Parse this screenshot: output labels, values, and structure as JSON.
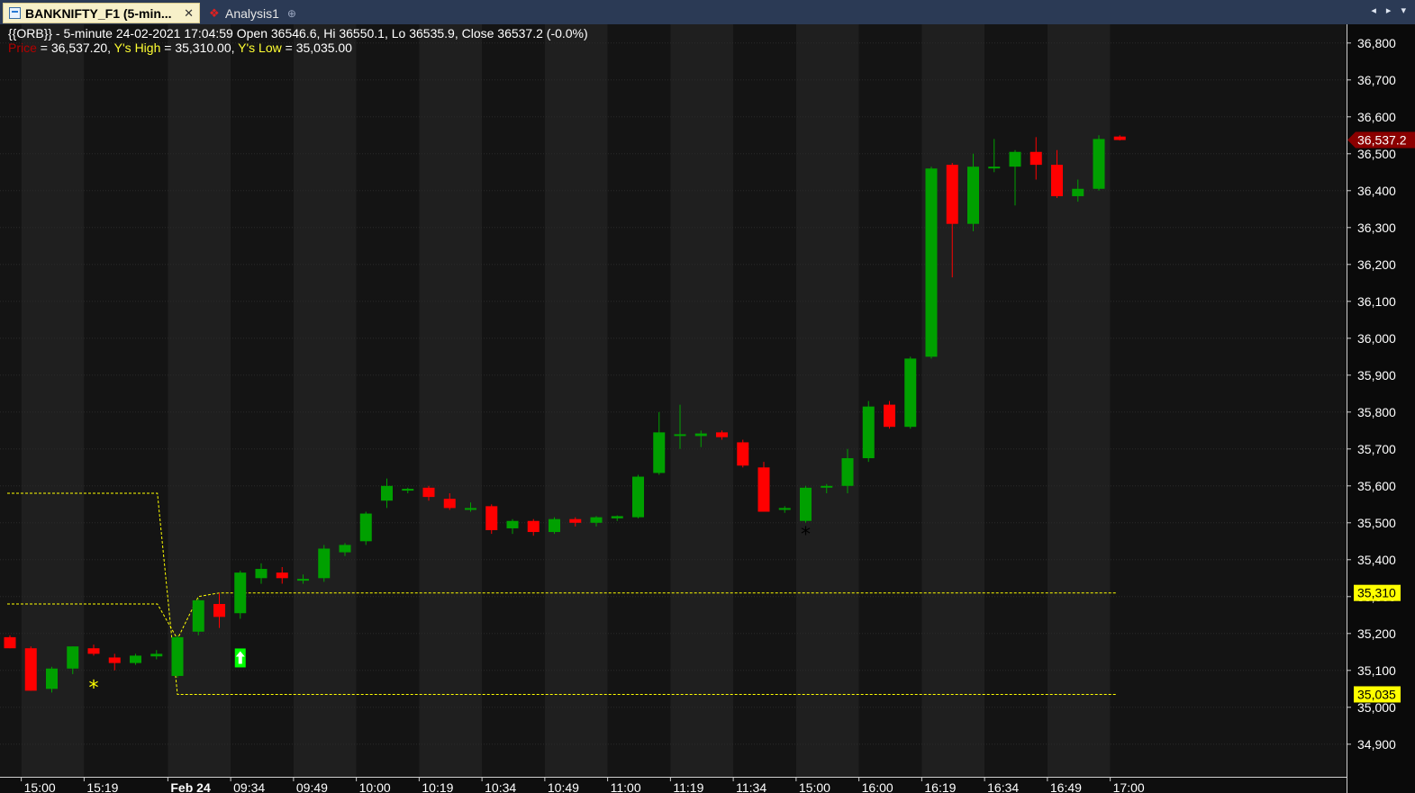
{
  "tabs": [
    {
      "label": "BANKNIFTY_F1 (5-min...",
      "active": true,
      "icon": "chart-window-icon"
    },
    {
      "label": "Analysis1",
      "active": false,
      "icon": "analysis-icon"
    }
  ],
  "info": {
    "line1": "{{ORB}} - 5-minute 24-02-2021 17:04:59 Open 36546.6, Hi 36550.1, Lo 36535.9, Close 36537.2 (-0.0%)",
    "price_label": "Price",
    "price_value": " = 36,537.20, ",
    "yhigh_label": "Y's High",
    "yhigh_value": " = 35,310.00, ",
    "ylow_label": "Y's Low",
    "ylow_value": " = 35,035.00"
  },
  "chart_data": {
    "type": "candlestick",
    "title": "",
    "ylim": [
      34840,
      36830
    ],
    "y_ticks": [
      34900,
      35000,
      35100,
      35200,
      35300,
      35400,
      35500,
      35600,
      35700,
      35800,
      35900,
      36000,
      36100,
      36200,
      36300,
      36400,
      36500,
      36600,
      36700,
      36800
    ],
    "y_tick_labels": [
      "34,900",
      "35,000",
      "35,100",
      "35,200",
      "35,300",
      "35,400",
      "35,500",
      "35,600",
      "35,700",
      "35,800",
      "35,900",
      "36,000",
      "36,100",
      "36,200",
      "36,300",
      "36,400",
      "36,500",
      "36,600",
      "36,700",
      "36,800"
    ],
    "x_tick_labels": [
      {
        "bar": 1,
        "label": "15:00",
        "bold": false
      },
      {
        "bar": 4,
        "label": "15:19",
        "bold": false
      },
      {
        "bar": 8,
        "label": "Feb 24",
        "bold": true
      },
      {
        "bar": 11,
        "label": "09:34",
        "bold": false
      },
      {
        "bar": 14,
        "label": "09:49",
        "bold": false
      },
      {
        "bar": 17,
        "label": "10:00",
        "bold": false
      },
      {
        "bar": 20,
        "label": "10:19",
        "bold": false
      },
      {
        "bar": 23,
        "label": "10:34",
        "bold": false
      },
      {
        "bar": 26,
        "label": "10:49",
        "bold": false
      },
      {
        "bar": 29,
        "label": "11:00",
        "bold": false
      },
      {
        "bar": 32,
        "label": "11:19",
        "bold": false
      },
      {
        "bar": 35,
        "label": "11:34",
        "bold": false
      },
      {
        "bar": 38,
        "label": "15:00",
        "bold": false
      },
      {
        "bar": 41,
        "label": "16:00",
        "bold": false
      },
      {
        "bar": 44,
        "label": "16:19",
        "bold": false
      },
      {
        "bar": 47,
        "label": "16:34",
        "bold": false
      },
      {
        "bar": 50,
        "label": "16:49",
        "bold": false
      },
      {
        "bar": 53,
        "label": "17:00",
        "bold": false
      }
    ],
    "candles": [
      {
        "o": 35190,
        "h": 35195,
        "l": 35160,
        "c": 35160
      },
      {
        "o": 35160,
        "h": 35165,
        "l": 35045,
        "c": 35045
      },
      {
        "o": 35050,
        "h": 35110,
        "l": 35040,
        "c": 35105
      },
      {
        "o": 35105,
        "h": 35165,
        "l": 35090,
        "c": 35165
      },
      {
        "o": 35160,
        "h": 35170,
        "l": 35140,
        "c": 35145
      },
      {
        "o": 35135,
        "h": 35145,
        "l": 35100,
        "c": 35120
      },
      {
        "o": 35120,
        "h": 35145,
        "l": 35115,
        "c": 35140
      },
      {
        "o": 35138,
        "h": 35155,
        "l": 35130,
        "c": 35145
      },
      {
        "o": 35085,
        "h": 35195,
        "l": 35080,
        "c": 35190
      },
      {
        "o": 35205,
        "h": 35295,
        "l": 35195,
        "c": 35290
      },
      {
        "o": 35280,
        "h": 35310,
        "l": 35215,
        "c": 35245
      },
      {
        "o": 35255,
        "h": 35370,
        "l": 35240,
        "c": 35365
      },
      {
        "o": 35350,
        "h": 35390,
        "l": 35335,
        "c": 35375
      },
      {
        "o": 35365,
        "h": 35380,
        "l": 35335,
        "c": 35350
      },
      {
        "o": 35345,
        "h": 35360,
        "l": 35335,
        "c": 35348
      },
      {
        "o": 35350,
        "h": 35440,
        "l": 35340,
        "c": 35430
      },
      {
        "o": 35420,
        "h": 35445,
        "l": 35410,
        "c": 35440
      },
      {
        "o": 35450,
        "h": 35530,
        "l": 35440,
        "c": 35525
      },
      {
        "o": 35560,
        "h": 35620,
        "l": 35540,
        "c": 35600
      },
      {
        "o": 35590,
        "h": 35595,
        "l": 35580,
        "c": 35592
      },
      {
        "o": 35595,
        "h": 35600,
        "l": 35560,
        "c": 35570
      },
      {
        "o": 35565,
        "h": 35580,
        "l": 35535,
        "c": 35540
      },
      {
        "o": 35535,
        "h": 35555,
        "l": 35530,
        "c": 35540
      },
      {
        "o": 35545,
        "h": 35550,
        "l": 35470,
        "c": 35480
      },
      {
        "o": 35485,
        "h": 35510,
        "l": 35470,
        "c": 35505
      },
      {
        "o": 35505,
        "h": 35510,
        "l": 35465,
        "c": 35475
      },
      {
        "o": 35475,
        "h": 35515,
        "l": 35470,
        "c": 35510
      },
      {
        "o": 35510,
        "h": 35515,
        "l": 35490,
        "c": 35500
      },
      {
        "o": 35500,
        "h": 35518,
        "l": 35490,
        "c": 35515
      },
      {
        "o": 35512,
        "h": 35520,
        "l": 35505,
        "c": 35518
      },
      {
        "o": 35515,
        "h": 35630,
        "l": 35512,
        "c": 35625
      },
      {
        "o": 35635,
        "h": 35800,
        "l": 35630,
        "c": 35745
      },
      {
        "o": 35740,
        "h": 35820,
        "l": 35700,
        "c": 35740
      },
      {
        "o": 35735,
        "h": 35750,
        "l": 35705,
        "c": 35742
      },
      {
        "o": 35745,
        "h": 35750,
        "l": 35725,
        "c": 35732
      },
      {
        "o": 35718,
        "h": 35725,
        "l": 35650,
        "c": 35655
      },
      {
        "o": 35650,
        "h": 35665,
        "l": 35530,
        "c": 35530
      },
      {
        "o": 35535,
        "h": 35545,
        "l": 35527,
        "c": 35540
      },
      {
        "o": 35505,
        "h": 35600,
        "l": 35500,
        "c": 35595
      },
      {
        "o": 35598,
        "h": 35605,
        "l": 35580,
        "c": 35600
      },
      {
        "o": 35600,
        "h": 35700,
        "l": 35580,
        "c": 35675
      },
      {
        "o": 35675,
        "h": 35830,
        "l": 35665,
        "c": 35815
      },
      {
        "o": 35820,
        "h": 35830,
        "l": 35755,
        "c": 35760
      },
      {
        "o": 35760,
        "h": 35950,
        "l": 35755,
        "c": 35945
      },
      {
        "o": 35950,
        "h": 36465,
        "l": 35945,
        "c": 36460
      },
      {
        "o": 36470,
        "h": 36475,
        "l": 36165,
        "c": 36310
      },
      {
        "o": 36310,
        "h": 36500,
        "l": 36290,
        "c": 36465
      },
      {
        "o": 36463,
        "h": 36540,
        "l": 36450,
        "c": 36465
      },
      {
        "o": 36465,
        "h": 36510,
        "l": 36360,
        "c": 36505
      },
      {
        "o": 36505,
        "h": 36545,
        "l": 36430,
        "c": 36470
      },
      {
        "o": 36470,
        "h": 36510,
        "l": 36380,
        "c": 36385
      },
      {
        "o": 36385,
        "h": 36430,
        "l": 36370,
        "c": 36405
      },
      {
        "o": 36405,
        "h": 36550,
        "l": 36400,
        "c": 36540
      },
      {
        "o": 36546.6,
        "h": 36550.1,
        "l": 36535.9,
        "c": 36537.2
      }
    ],
    "yhigh_line": {
      "prev": 35280,
      "today": 35310,
      "label": "35,310"
    },
    "ylow_line": {
      "prev": 35580,
      "today": 35035,
      "label": "35,035"
    },
    "last_price_label": "36,537.2",
    "markers": [
      {
        "type": "star",
        "bar": 4,
        "price": 35055,
        "color": "#ffff00",
        "symbol": "*"
      },
      {
        "type": "up-arrow",
        "bar": 11,
        "price": 35135,
        "color": "#00ff00"
      },
      {
        "type": "star",
        "bar": 38,
        "price": 35470,
        "color": "#000000",
        "symbol": "*"
      }
    ],
    "colors": {
      "up": "#00a000",
      "down": "#ff0000",
      "background": "#0e0e0e",
      "shade_light": "#1f1f1f",
      "shade_dark": "#141414",
      "level_line": "#ffff00",
      "axis_label_bg": "#ffff00",
      "last_price_bg": "#8b0000"
    }
  }
}
